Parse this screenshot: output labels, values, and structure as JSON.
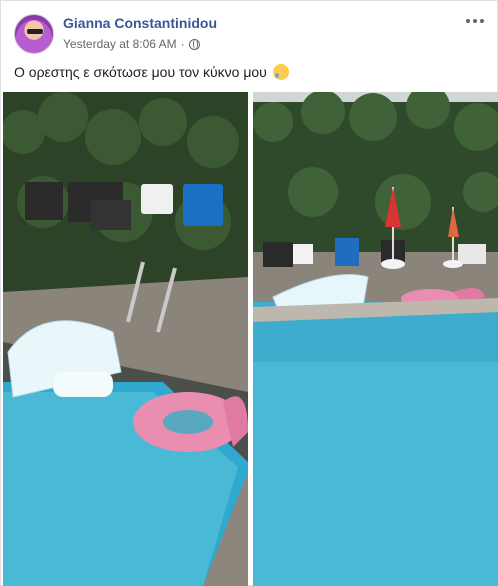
{
  "post": {
    "author": "Gianna Constantinidou",
    "timestamp": "Yesterday at 8:06 AM",
    "separator": "·",
    "privacy_icon": "globe-icon",
    "more_icon": "ellipsis-icon",
    "message": "Ο ορεστης ε σκότωσε μου τον κύκνο μου",
    "emoji": "sad-tear-emoji"
  },
  "colors": {
    "author_link": "#385898",
    "meta_text": "#616770",
    "pool_water": "#49b9d6",
    "hedge": "#2f4a2a"
  },
  "photos": [
    {
      "name": "photo-left",
      "subject": "pool-close-up"
    },
    {
      "name": "photo-right",
      "subject": "pool-wide-view"
    }
  ]
}
